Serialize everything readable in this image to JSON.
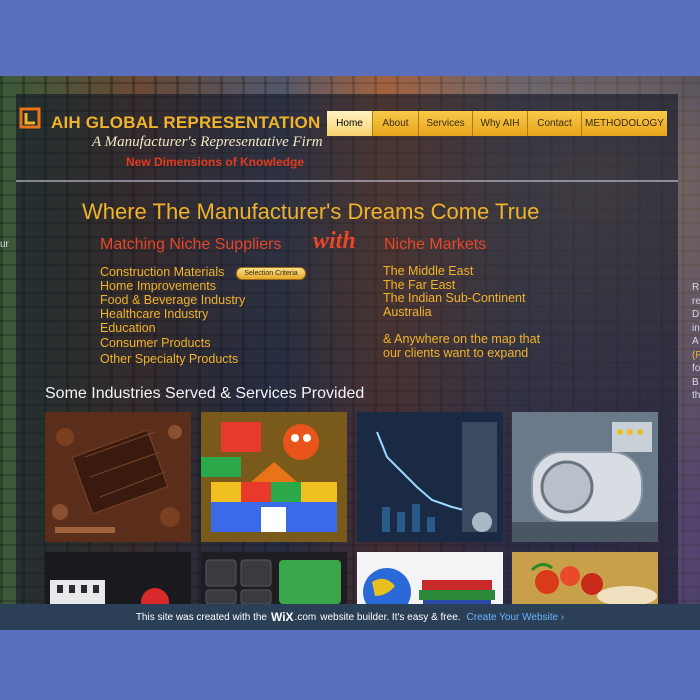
{
  "header": {
    "title": "AIH GLOBAL REPRESENTATION",
    "tagline": "A Manufacturer's Representative Firm",
    "subtitle": "New Dimensions of Knowledge"
  },
  "nav": {
    "items": [
      {
        "label": "Home"
      },
      {
        "label": "About"
      },
      {
        "label": "Services"
      },
      {
        "label": "Why AIH"
      },
      {
        "label": "Contact"
      },
      {
        "label": "METHODOLOGY"
      }
    ]
  },
  "hero": {
    "headline": "Where The Manufacturer's Dreams Come True",
    "left_heading": "Matching Niche Suppliers",
    "connector": "with",
    "right_heading": "Niche Markets",
    "selection_button": "Selection Criteria",
    "suppliers": [
      "Construction Materials",
      "Home Improvements",
      "Food & Beverage Industry",
      "Healthcare Industry",
      "Education",
      "Consumer Products",
      "Other Specialty Products"
    ],
    "markets": [
      "The Middle East",
      "The Far East",
      "The Indian Sub-Continent",
      "Australia",
      "& Anywhere on the map that",
      "our clients want to expand"
    ]
  },
  "industries": {
    "heading": "Some Industries Served & Services Provided",
    "tiles": [
      "chocolate-image",
      "toys-image",
      "chart-image",
      "machinery-image",
      "building-image",
      "keyboard-image",
      "books-globe-image",
      "food-image"
    ]
  },
  "edge_text": {
    "left": "ur",
    "right_lines": [
      "R",
      "re",
      "D",
      "in",
      "A",
      "(F",
      "fo",
      "B",
      "th"
    ]
  },
  "wix_banner": {
    "prefix": "This site was created with the",
    "logo": "WiX",
    "logo_suffix": ".com",
    "suffix": "website builder. It's easy & free.",
    "cta": "Create Your Website ›"
  },
  "colors": {
    "accent_gold": "#f0b32a",
    "accent_red": "#e8452a",
    "banner_bg": "#2b3f57",
    "page_bg": "#5b6fbf"
  }
}
